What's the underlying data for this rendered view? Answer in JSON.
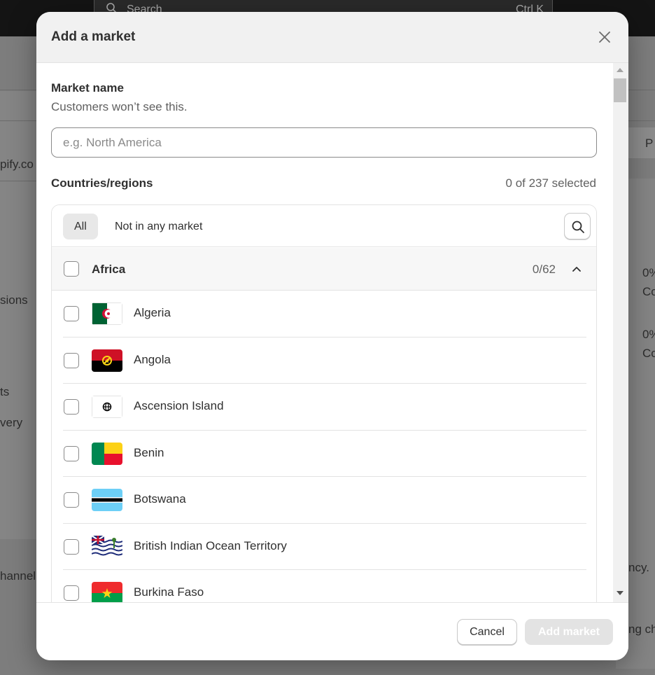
{
  "background": {
    "search_placeholder": "Search",
    "search_shortcut": "Ctrl K",
    "partial_texts": [
      "pify.co",
      "sions",
      "ts",
      "very",
      "hannel",
      "0%",
      "Co",
      "0%",
      "Co",
      "ncy.",
      "ng ch",
      "P"
    ]
  },
  "modal": {
    "title": "Add a market",
    "market_name": {
      "label": "Market name",
      "help_text": "Customers won’t see this.",
      "placeholder": "e.g. North America",
      "value": ""
    },
    "countries": {
      "label": "Countries/regions",
      "selected_text": "0 of 237 selected",
      "filters": [
        {
          "label": "All",
          "active": true
        },
        {
          "label": "Not in any market",
          "active": false
        }
      ],
      "group": {
        "name": "Africa",
        "count": "0/62",
        "expanded": true
      },
      "items": [
        {
          "name": "Algeria",
          "flag": "algeria-flag-icon",
          "checked": false
        },
        {
          "name": "Angola",
          "flag": "angola-flag-icon",
          "checked": false
        },
        {
          "name": "Ascension Island",
          "flag": "globe-icon",
          "checked": false
        },
        {
          "name": "Benin",
          "flag": "benin-flag-icon",
          "checked": false
        },
        {
          "name": "Botswana",
          "flag": "botswana-flag-icon",
          "checked": false
        },
        {
          "name": "British Indian Ocean Territory",
          "flag": "british-indian-ocean-territory-flag-icon",
          "checked": false
        },
        {
          "name": "Burkina Faso",
          "flag": "burkina-faso-flag-icon",
          "checked": false
        }
      ]
    },
    "footer": {
      "cancel_label": "Cancel",
      "add_label": "Add market"
    }
  },
  "colors": {
    "overlay_dim": "#7d7d7d",
    "primary_disabled": "#e3e3e3",
    "text": "#303030",
    "subdued_text": "#616161"
  }
}
